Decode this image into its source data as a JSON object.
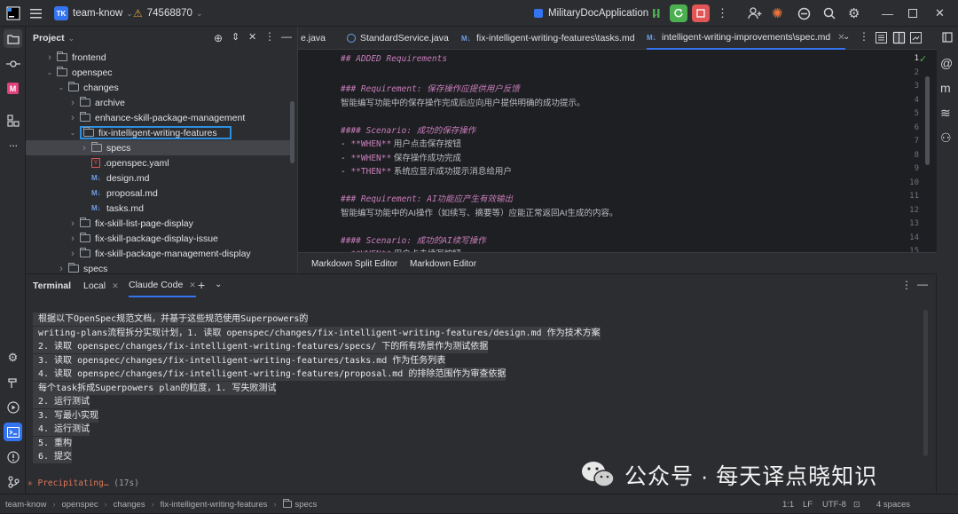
{
  "titlebar": {
    "project_badge": "TK",
    "project_name": "team-know",
    "branch": "74568870",
    "run_config": "MilitaryDocApplication"
  },
  "project_panel": {
    "title": "Project",
    "tree": [
      {
        "label": "frontend",
        "type": "folder",
        "depth": 2,
        "expanded": false
      },
      {
        "label": "openspec",
        "type": "folder",
        "depth": 2,
        "expanded": true
      },
      {
        "label": "changes",
        "type": "folder",
        "depth": 3,
        "expanded": true
      },
      {
        "label": "archive",
        "type": "folder",
        "depth": 4,
        "expanded": false
      },
      {
        "label": "enhance-skill-package-management",
        "type": "folder",
        "depth": 4,
        "expanded": false
      },
      {
        "label": "fix-intelligent-writing-features",
        "type": "folder",
        "depth": 4,
        "expanded": true,
        "highlighted": true
      },
      {
        "label": "specs",
        "type": "folder",
        "depth": 5,
        "expanded": false,
        "selected": true
      },
      {
        "label": ".openspec.yaml",
        "type": "yaml",
        "depth": 5
      },
      {
        "label": "design.md",
        "type": "md",
        "depth": 5
      },
      {
        "label": "proposal.md",
        "type": "md",
        "depth": 5
      },
      {
        "label": "tasks.md",
        "type": "md",
        "depth": 5
      },
      {
        "label": "fix-skill-list-page-display",
        "type": "folder",
        "depth": 4,
        "expanded": false
      },
      {
        "label": "fix-skill-package-display-issue",
        "type": "folder",
        "depth": 4,
        "expanded": false
      },
      {
        "label": "fix-skill-package-management-display",
        "type": "folder",
        "depth": 4,
        "expanded": false
      },
      {
        "label": "specs",
        "type": "folder",
        "depth": 3,
        "expanded": false
      }
    ]
  },
  "editor": {
    "tabs": [
      {
        "label": "e.java",
        "icon": "java"
      },
      {
        "label": "StandardService.java",
        "icon": "service"
      },
      {
        "label": "fix-intelligent-writing-features\\tasks.md",
        "icon": "md"
      },
      {
        "label": "intelligent-writing-improvements\\spec.md",
        "icon": "md",
        "active": true
      }
    ],
    "md_badge": "M↓",
    "lines": [
      {
        "n": "1",
        "kind": "h2",
        "text": "## ADDED Requirements"
      },
      {
        "n": "2",
        "kind": "blank",
        "text": ""
      },
      {
        "n": "3",
        "kind": "h3",
        "text": "### Requirement: 保存操作应提供用户反馈"
      },
      {
        "n": "4",
        "kind": "plain",
        "text": "智能编写功能中的保存操作完成后应向用户提供明确的成功提示。"
      },
      {
        "n": "5",
        "kind": "blank",
        "text": ""
      },
      {
        "n": "6",
        "kind": "h4",
        "text": "#### Scenario: 成功的保存操作"
      },
      {
        "n": "7",
        "kind": "bullet",
        "prefix": "- ",
        "keyword": "**WHEN**",
        "rest": " 用户点击保存按钮"
      },
      {
        "n": "8",
        "kind": "bullet",
        "prefix": "- ",
        "keyword": "**WHEN**",
        "rest": " 保存操作成功完成"
      },
      {
        "n": "9",
        "kind": "bullet",
        "prefix": "- ",
        "keyword": "**THEN**",
        "rest": " 系统应显示成功提示消息给用户"
      },
      {
        "n": "10",
        "kind": "blank",
        "text": ""
      },
      {
        "n": "11",
        "kind": "h3",
        "text": "### Requirement: AI功能应产生有效输出"
      },
      {
        "n": "12",
        "kind": "plain",
        "text": "智能编写功能中的AI操作（如续写、摘要等）应能正常返回AI生成的内容。"
      },
      {
        "n": "13",
        "kind": "blank",
        "text": ""
      },
      {
        "n": "14",
        "kind": "h4",
        "text": "#### Scenario: 成功的AI续写操作"
      },
      {
        "n": "15",
        "kind": "bullet",
        "prefix": "- ",
        "keyword": "**WHEN**",
        "rest": " 用户点击续写按钮"
      }
    ],
    "bottom_tabs": [
      "Markdown Split Editor",
      "Markdown Editor"
    ]
  },
  "terminal": {
    "label": "Terminal",
    "tabs": [
      "Local",
      "Claude Code"
    ],
    "active_tab": "Claude Code",
    "lines": [
      "根据以下OpenSpec规范文档，并基于这些规范使用Superpowers的",
      "writing-plans流程拆分实现计划，1. 读取 openspec/changes/fix-intelligent-writing-features/design.md 作为技术方案",
      "2. 读取 openspec/changes/fix-intelligent-writing-features/specs/ 下的所有场景作为测试依据",
      "3. 读取 openspec/changes/fix-intelligent-writing-features/tasks.md 作为任务列表",
      "4. 读取 openspec/changes/fix-intelligent-writing-features/proposal.md 的排除范围作为审查依据",
      "每个task拆成Superpowers plan的粒度，1. 写失败测试",
      "2. 运行测试",
      "3. 写最小实现",
      "4. 运行测试",
      "5. 重构",
      "6. 提交"
    ],
    "status_glyph": "✳",
    "status": "Precipitating…",
    "elapsed": "(17s)"
  },
  "statusbar": {
    "breadcrumb": [
      "team-know",
      "openspec",
      "changes",
      "fix-intelligent-writing-features",
      "specs"
    ],
    "position": "1:1",
    "line_ending": "LF",
    "encoding": "UTF-8",
    "indent": "4 spaces"
  },
  "watermark": {
    "text": "公众号 · 每天译点晓知识"
  },
  "colors": {
    "accent": "#3574f0",
    "heading": "#c77dbb",
    "stop": "#e05555",
    "run": "#4caf50"
  }
}
